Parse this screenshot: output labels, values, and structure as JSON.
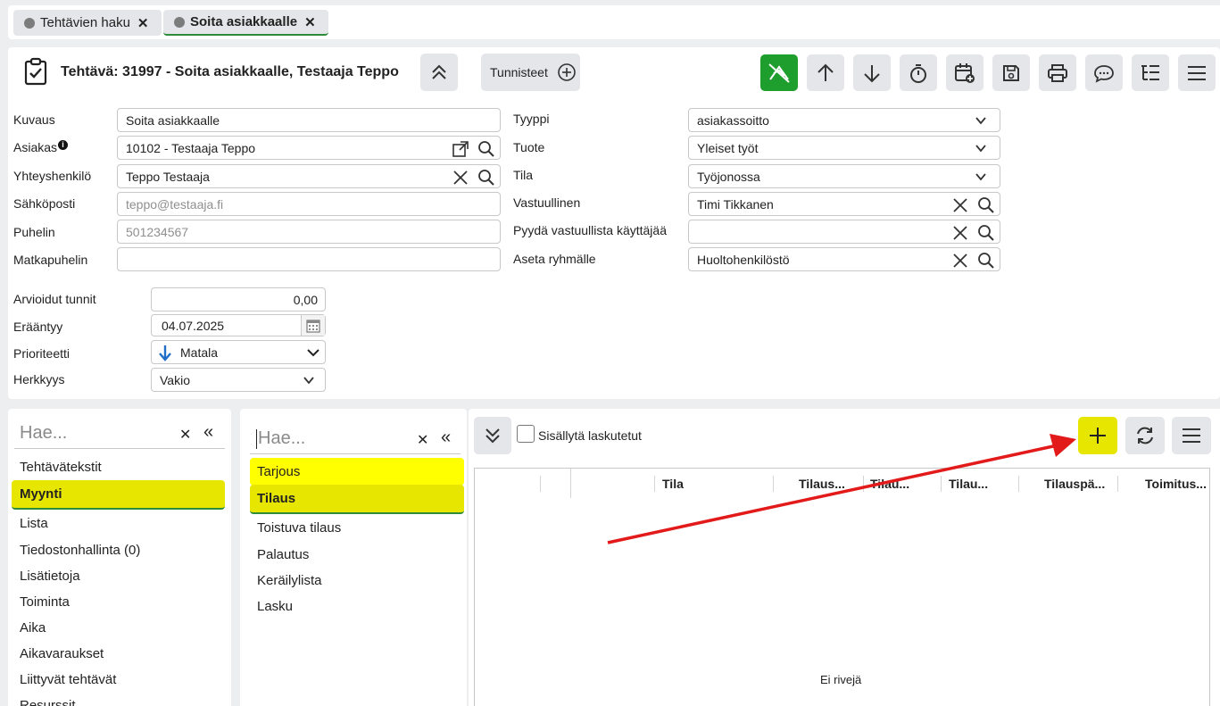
{
  "tabs": [
    {
      "label": "Tehtävien haku"
    },
    {
      "label": "Soita asiakkaalle"
    }
  ],
  "header": {
    "title": "Tehtävä: 31997 - Soita asiakkaalle, Testaaja Teppo",
    "tags_label": "Tunnisteet"
  },
  "form_left": {
    "kuvaus_label": "Kuvaus",
    "kuvaus_value": "Soita asiakkaalle",
    "asiakas_label": "Asiakas",
    "asiakas_value": "10102 - Testaaja Teppo",
    "yhteys_label": "Yhteyshenkilö",
    "yhteys_value": "Teppo Testaaja",
    "email_label": "Sähköposti",
    "email_placeholder": "teppo@testaaja.fi",
    "puhelin_label": "Puhelin",
    "puhelin_placeholder": "501234567",
    "matka_label": "Matkapuhelin",
    "matka_value": ""
  },
  "form_right": {
    "tyyppi_label": "Tyyppi",
    "tyyppi_value": "asiakassoitto",
    "tuote_label": "Tuote",
    "tuote_value": "Yleiset työt",
    "tila_label": "Tila",
    "tila_value": "Työjonossa",
    "vastuu_label": "Vastuullinen",
    "vastuu_value": "Timi Tikkanen",
    "pyyda_label": "Pyydä vastuullista käyttäjää",
    "pyyda_value": "",
    "ryhma_label": "Aseta ryhmälle",
    "ryhma_value": "Huoltohenkilöstö"
  },
  "form_bottom": {
    "tunnit_label": "Arvioidut tunnit",
    "tunnit_value": "0,00",
    "erantyy_label": "Erääntyy",
    "erantyy_value": "04.07.2025",
    "prio_label": "Prioriteetti",
    "prio_value": "Matala",
    "herkkyys_label": "Herkkyys",
    "herkkyys_value": "Vakio"
  },
  "left_nav": {
    "search_placeholder": "Hae...",
    "items": [
      "Tehtävätekstit",
      "Myynti",
      "Lista",
      "Tiedostonhallinta (0)",
      "Lisätietoja",
      "Toiminta",
      "Aika",
      "Aikavaraukset",
      "Liittyvät tehtävät",
      "Resurssit"
    ]
  },
  "mid_nav": {
    "search_placeholder": "Hae...",
    "items": [
      "Tarjous",
      "Tilaus",
      "Toistuva tilaus",
      "Palautus",
      "Keräilylista",
      "Lasku"
    ]
  },
  "grid": {
    "checkbox_label": "Sisällytä laskutetut",
    "columns": [
      "Tila",
      "Tilaus...",
      "Tilau...",
      "Tilau...",
      "Tilauspä...",
      "Toimitus..."
    ],
    "empty_text": "Ei rivejä"
  },
  "colors": {
    "accent_green": "#1e9e2c",
    "highlight_yellow": "#e6e600",
    "arrow_red": "#e21a1a"
  }
}
